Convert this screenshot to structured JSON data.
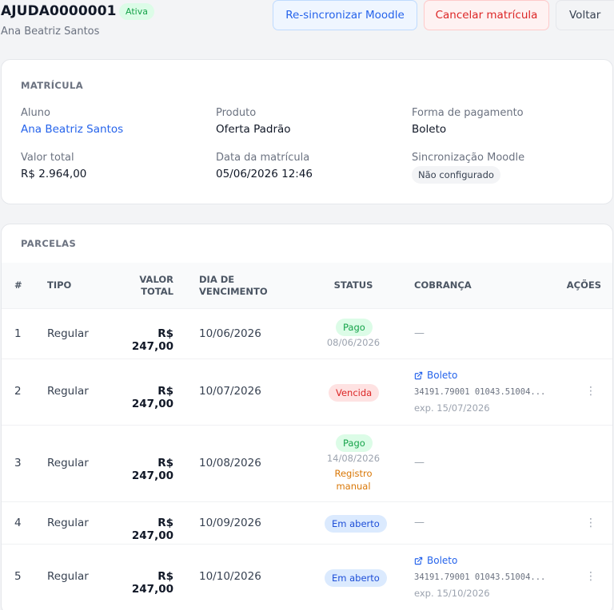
{
  "header": {
    "code": "AJUDA0000001",
    "status_badge": "Ativa",
    "student_name": "Ana Beatriz Santos",
    "buttons": {
      "resync": "Re-sincronizar Moodle",
      "cancel": "Cancelar matrícula",
      "back": "Voltar"
    }
  },
  "matricula": {
    "title": "MATRÍCULA",
    "aluno_label": "Aluno",
    "aluno_value": "Ana Beatriz Santos",
    "produto_label": "Produto",
    "produto_value": "Oferta Padrão",
    "pagamento_label": "Forma de pagamento",
    "pagamento_value": "Boleto",
    "valor_label": "Valor total",
    "valor_value": "R$ 2.964,00",
    "data_label": "Data da matrícula",
    "data_value": "05/06/2026 12:46",
    "sync_label": "Sincronização Moodle",
    "sync_value": "Não configurado"
  },
  "parcelas": {
    "title": "PARCELAS",
    "columns": {
      "num": "#",
      "tipo": "TIPO",
      "valor_l1": "VALOR",
      "valor_l2": "TOTAL",
      "venc_l1": "DIA DE",
      "venc_l2": "VENCIMENTO",
      "status": "STATUS",
      "cobranca": "COBRANÇA",
      "acoes": "AÇÕES"
    },
    "rows": [
      {
        "num": "1",
        "tipo": "Regular",
        "valor": "R$ 247,00",
        "vencimento": "10/06/2026",
        "status": "Pago",
        "status_date": "08/06/2026",
        "cobranca": "—"
      },
      {
        "num": "2",
        "tipo": "Regular",
        "valor": "R$ 247,00",
        "vencimento": "10/07/2026",
        "status": "Vencida",
        "boleto_label": "Boleto",
        "boleto_code": "34191.79001 01043.51004...",
        "boleto_exp": "exp. 15/07/2026",
        "menu_icon": "⋮"
      },
      {
        "num": "3",
        "tipo": "Regular",
        "valor": "R$ 247,00",
        "vencimento": "10/08/2026",
        "status": "Pago",
        "status_date": "14/08/2026",
        "status_note_l1": "Registro",
        "status_note_l2": "manual",
        "cobranca": "—"
      },
      {
        "num": "4",
        "tipo": "Regular",
        "valor": "R$ 247,00",
        "vencimento": "10/09/2026",
        "status": "Em aberto",
        "cobranca": "—",
        "menu_icon": "⋮"
      },
      {
        "num": "5",
        "tipo": "Regular",
        "valor": "R$ 247,00",
        "vencimento": "10/10/2026",
        "status": "Em aberto",
        "boleto_label": "Boleto",
        "boleto_code": "34191.79001 01043.51004...",
        "boleto_exp": "exp. 15/10/2026",
        "menu_icon": "⋮"
      }
    ]
  },
  "colors": {
    "primary": "#2563eb",
    "danger": "#dc2626",
    "success": "#16a34a",
    "warning": "#d97706"
  },
  "icons": {
    "external_link": "external-link-icon",
    "more_vertical": "more-vertical-icon"
  }
}
